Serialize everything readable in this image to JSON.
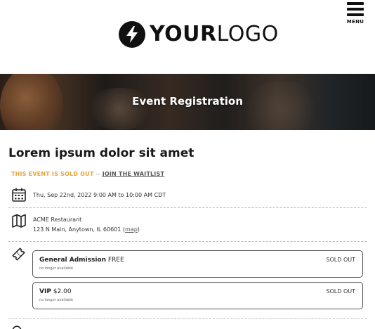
{
  "header": {
    "logo_bold": "YOUR",
    "logo_light": "LOGO",
    "menu_label": "MENU"
  },
  "banner": {
    "title": "Event Registration"
  },
  "event": {
    "title": "Lorem ipsum dolor sit amet",
    "sold_out_text": "THIS EVENT IS SOLD OUT",
    "separator": "--",
    "waitlist_link": "JOIN THE WAITLIST",
    "datetime": "Thu, Sep 22nd, 2022 9:00 AM to 10:00 AM CDT",
    "venue_name": "ACME Restaurant",
    "venue_address": "123 N Main, Anytown, IL 60601",
    "map_open": "(",
    "map_link": "map",
    "map_close": ")"
  },
  "tickets": [
    {
      "name": "General Admission",
      "price": "FREE",
      "sub": "no longer available",
      "status": "SOLD OUT"
    },
    {
      "name": "VIP",
      "price": "$2.00",
      "sub": "no longer available",
      "status": "SOLD OUT"
    }
  ],
  "icons": {
    "logo": "lightning-bolt-icon",
    "menu": "hamburger-menu-icon",
    "date": "calendar-icon",
    "location": "map-icon",
    "tickets": "ticket-icon"
  },
  "colors": {
    "sold_out": "#e8a23a",
    "logo_dark": "#111111"
  }
}
